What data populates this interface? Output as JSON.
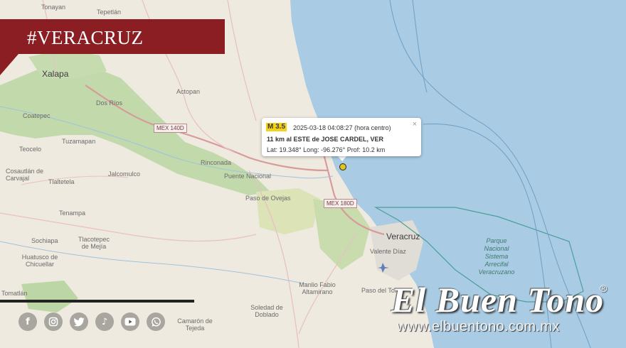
{
  "banner": {
    "label": "#VERACRUZ",
    "color": "#8b1e23"
  },
  "map": {
    "places": [
      {
        "id": "tonayan",
        "text": "Tonayan"
      },
      {
        "id": "tepetlan",
        "text": "Tepetlán"
      },
      {
        "id": "xalapa",
        "text": "Xalapa"
      },
      {
        "id": "dos-rios",
        "text": "Dos Ríos"
      },
      {
        "id": "actopan",
        "text": "Actopan"
      },
      {
        "id": "coatepec",
        "text": "Coatepec"
      },
      {
        "id": "tuzamapan",
        "text": "Tuzamapan"
      },
      {
        "id": "teocelo",
        "text": "Teocelo"
      },
      {
        "id": "cosautlan",
        "text": "Cosautlán de Carvajal"
      },
      {
        "id": "jalcomulco",
        "text": "Jalcomulco"
      },
      {
        "id": "tlaltetela",
        "text": "Tlaltetela"
      },
      {
        "id": "tlacotepec",
        "text": "Tlacotepec de Mejía"
      },
      {
        "id": "tenampa",
        "text": "Tenampa"
      },
      {
        "id": "sochiapa",
        "text": "Sochiapa"
      },
      {
        "id": "huatusco",
        "text": "Huatusco de Chicuellar"
      },
      {
        "id": "tomatlan",
        "text": "Tomatlán"
      },
      {
        "id": "rinconada",
        "text": "Rinconada"
      },
      {
        "id": "puente-nacional",
        "text": "Puente Nacional"
      },
      {
        "id": "paso-de-ovejas",
        "text": "Paso de Ovejas"
      },
      {
        "id": "veracruz",
        "text": "Veracruz"
      },
      {
        "id": "valente-diaz",
        "text": "Valente Díaz"
      },
      {
        "id": "manlio-fabio",
        "text": "Manlio Fabio Altamirano"
      },
      {
        "id": "paso-del-toro",
        "text": "Paso del Toro"
      },
      {
        "id": "soledad-doblado",
        "text": "Soledad de Doblado"
      },
      {
        "id": "camarón",
        "text": "Camarón de Tejeda"
      }
    ],
    "roads": [
      {
        "id": "mex140d",
        "text": "MEX 140D"
      },
      {
        "id": "mex180d",
        "text": "MEX 180D"
      }
    ],
    "park": "Parque Nacional Sistema Arrecifal Veracruzano",
    "colors": {
      "sea": "#a9cbe3",
      "land": "#efeae0",
      "forest": "#bcd7a5",
      "park_boundary": "#4d9e9a"
    }
  },
  "popup": {
    "magnitude": "M 3.5",
    "datetime": "2025-03-18  04:08:27 (hora centro)",
    "location": "11 km al ESTE de JOSE CARDEL, VER",
    "coords": "Lat: 19.348°  Long: -96.276°  Prof: 10.2 km",
    "close": "×"
  },
  "socials": [
    {
      "id": "facebook",
      "icon": "facebook-icon",
      "glyph": "f"
    },
    {
      "id": "instagram",
      "icon": "instagram-icon",
      "glyph": ""
    },
    {
      "id": "twitter",
      "icon": "twitter-icon",
      "glyph": ""
    },
    {
      "id": "tiktok",
      "icon": "tiktok-icon",
      "glyph": "♪"
    },
    {
      "id": "youtube",
      "icon": "youtube-icon",
      "glyph": ""
    },
    {
      "id": "whatsapp",
      "icon": "whatsapp-icon",
      "glyph": ""
    }
  ],
  "brand": {
    "name": "El Buen Tono",
    "registered": "®",
    "url": "www.elbuentono.com.mx"
  }
}
